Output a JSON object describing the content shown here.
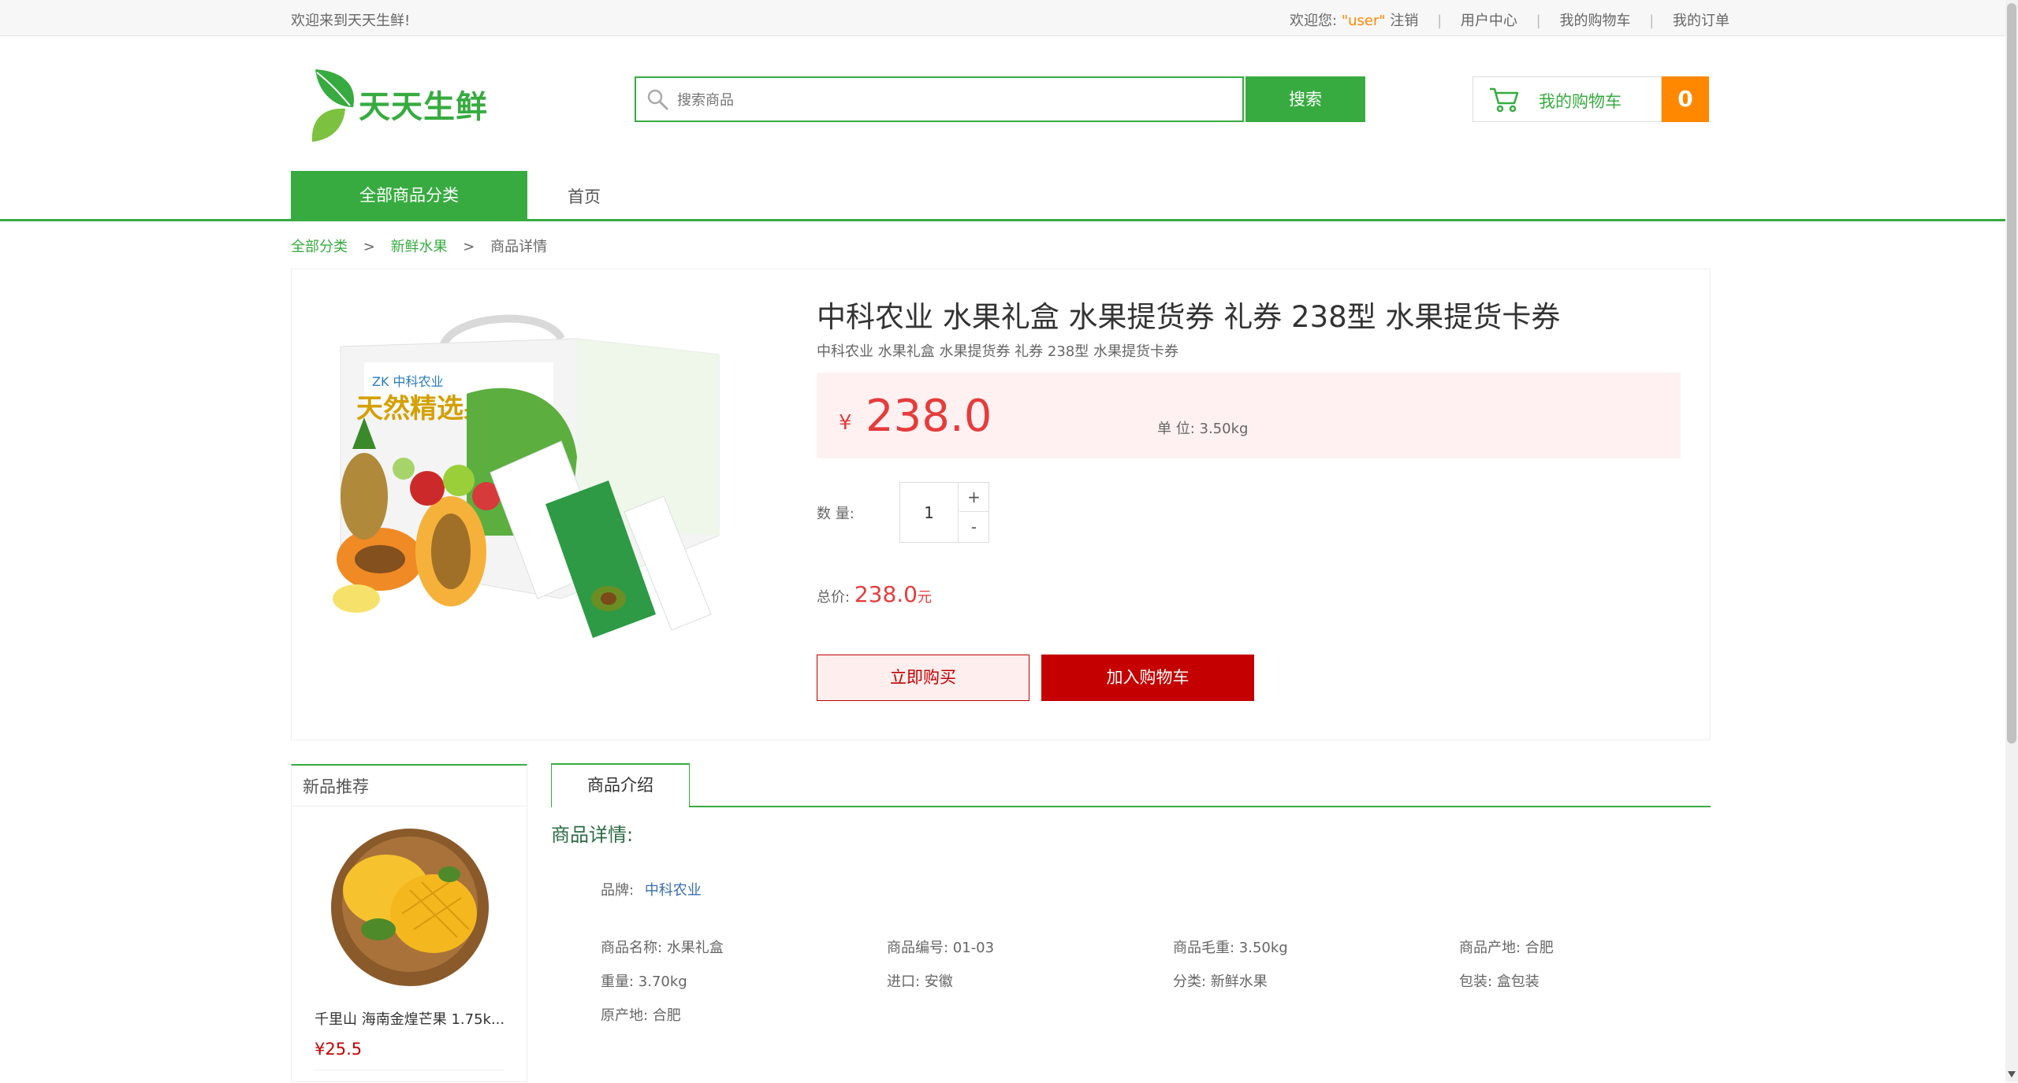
{
  "topbar": {
    "welcome": "欢迎来到天天生鲜!",
    "greeting": "欢迎您:",
    "username": "\"user\"",
    "logout": "注销",
    "user_center": "用户中心",
    "my_cart": "我的购物车",
    "my_orders": "我的订单"
  },
  "header": {
    "logo_text": "天天生鲜",
    "search_placeholder": "搜索商品",
    "search_button": "搜索",
    "cart_label": "我的购物车",
    "cart_count": "0"
  },
  "nav": {
    "all_categories": "全部商品分类",
    "home": "首页"
  },
  "breadcrumb": {
    "all": "全部分类",
    "sep": ">",
    "category": "新鲜水果",
    "current": "商品详情"
  },
  "product": {
    "title": "中科农业 水果礼盒 水果提货券 礼券 238型 水果提货卡券",
    "subtitle": "中科农业 水果礼盒 水果提货券 礼券 238型 水果提货卡券",
    "currency": "¥",
    "price": "238.0",
    "unit": "单 位:  3.50kg",
    "qty_label": "数 量:",
    "qty_value": "1",
    "qty_plus": "+",
    "qty_minus": "-",
    "total_label": "总价:",
    "total_value": "238.0",
    "total_unit": "元",
    "buy_now": "立即购买",
    "add_to_cart": "加入购物车"
  },
  "sidebar": {
    "title": "新品推荐",
    "items": [
      {
        "name": "千里山 海南金煌芒果 1.75k...",
        "price": "¥25.5"
      }
    ]
  },
  "detail": {
    "tab": "商品介绍",
    "heading": "商品详情:",
    "brand_label": "品牌:",
    "brand_value": "中科农业",
    "fields": [
      "商品名称: 水果礼盒",
      "商品编号: 01-03",
      "商品毛重: 3.50kg",
      "商品产地: 合肥",
      "重量: 3.70kg",
      "进口: 安徽",
      "分类: 新鲜水果",
      "包装: 盒包装",
      "原产地: 合肥"
    ]
  },
  "colors": {
    "brand_green": "#37ab40",
    "price_red": "#e53c3c",
    "button_red": "#c40000",
    "cart_orange": "#ff8800"
  }
}
